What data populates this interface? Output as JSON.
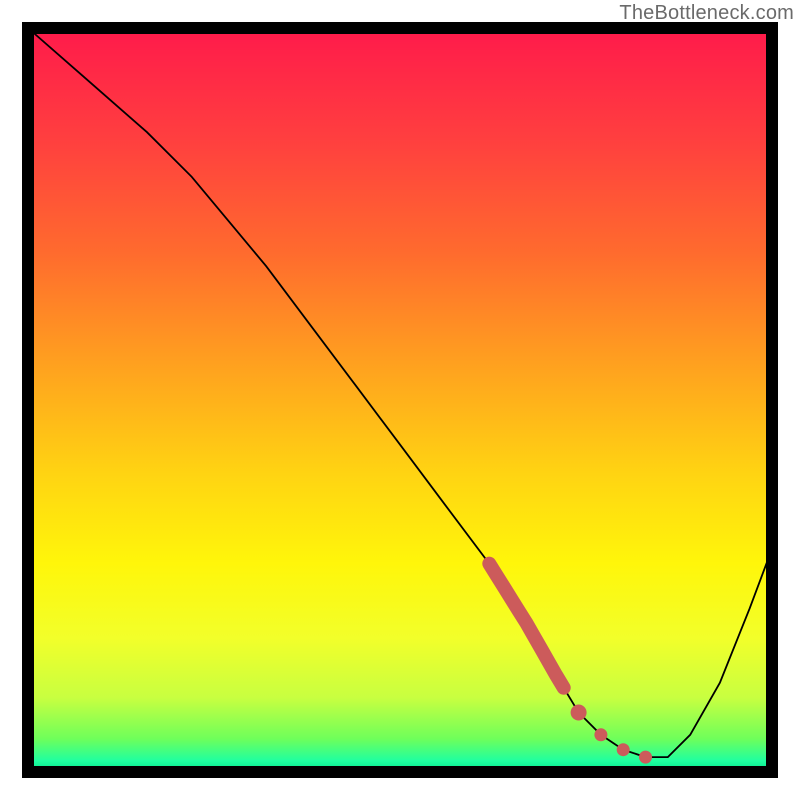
{
  "watermark": "TheBottleneck.com",
  "chart_data": {
    "type": "line",
    "title": "",
    "xlabel": "",
    "ylabel": "",
    "xlim": [
      0,
      100
    ],
    "ylim": [
      0,
      100
    ],
    "background_gradient_stops": [
      {
        "offset": 0.0,
        "color": "#ff1a4b"
      },
      {
        "offset": 0.15,
        "color": "#ff3f3f"
      },
      {
        "offset": 0.3,
        "color": "#ff6a2e"
      },
      {
        "offset": 0.45,
        "color": "#ffa01f"
      },
      {
        "offset": 0.6,
        "color": "#ffd412"
      },
      {
        "offset": 0.72,
        "color": "#fff60a"
      },
      {
        "offset": 0.82,
        "color": "#f2ff2a"
      },
      {
        "offset": 0.9,
        "color": "#c8ff40"
      },
      {
        "offset": 0.955,
        "color": "#6fff5a"
      },
      {
        "offset": 0.985,
        "color": "#1fffa0"
      },
      {
        "offset": 1.0,
        "color": "#00e58a"
      }
    ],
    "series": [
      {
        "name": "bottleneck-curve",
        "x": [
          0,
          8,
          16,
          22,
          27,
          32,
          38,
          44,
          50,
          56,
          62,
          67,
          71,
          74,
          77,
          80,
          83,
          86,
          89,
          93,
          97,
          100
        ],
        "y": [
          100,
          93,
          86,
          80,
          74,
          68,
          60,
          52,
          44,
          36,
          28,
          20,
          13,
          8,
          5,
          3,
          2,
          2,
          5,
          12,
          22,
          30
        ]
      }
    ],
    "highlight_marker": {
      "series": "bottleneck-curve",
      "color": "#cc5b5b",
      "thick_segment": {
        "x_start": 62,
        "x_end": 72
      },
      "dots_x": [
        74,
        77,
        80,
        83
      ]
    }
  }
}
